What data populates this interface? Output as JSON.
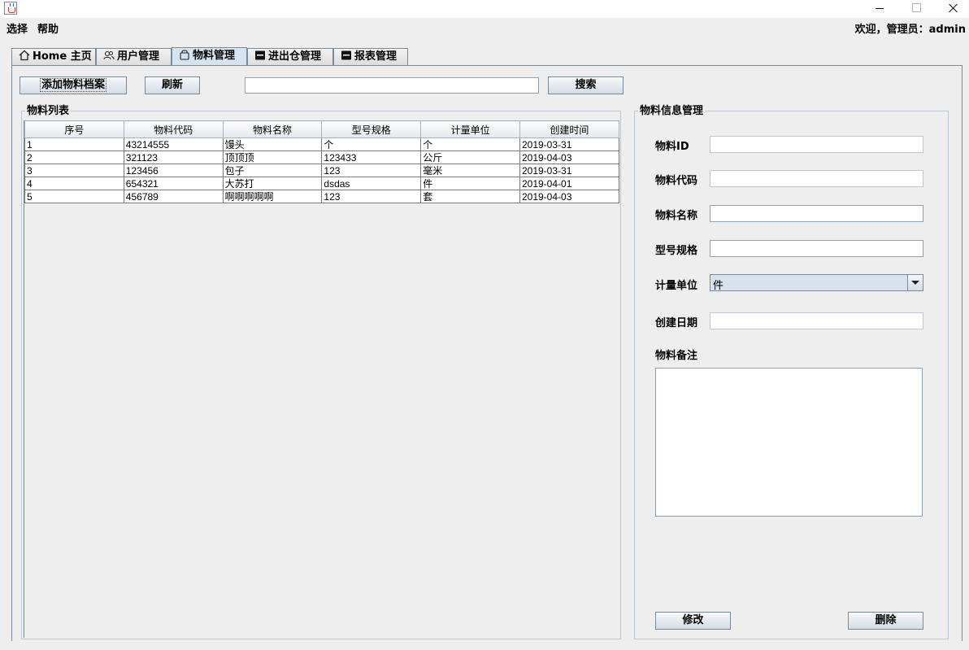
{
  "menu": {
    "select": "选择",
    "help": "帮助"
  },
  "welcome": "欢迎，管理员：admin",
  "tabs": [
    {
      "label": "Home 主页",
      "icon": "home-icon"
    },
    {
      "label": "用户管理",
      "icon": "users-icon"
    },
    {
      "label": "物料管理",
      "icon": "bag-icon"
    },
    {
      "label": "进出仓管理",
      "icon": "box-icon"
    },
    {
      "label": "报表管理",
      "icon": "box-icon"
    }
  ],
  "active_tab": "物料管理",
  "toolbar": {
    "add_label": "添加物料档案",
    "refresh_label": "刷新",
    "search_value": "",
    "search_label": "搜索"
  },
  "list": {
    "title": "物料列表",
    "columns": [
      "序号",
      "物料代码",
      "物料名称",
      "型号规格",
      "计量单位",
      "创建时间"
    ],
    "rows": [
      [
        "1",
        "43214555",
        "馒头",
        "个",
        "个",
        "2019-03-31"
      ],
      [
        "2",
        "321123",
        "顶顶顶",
        "123433",
        "公斤",
        "2019-04-03"
      ],
      [
        "3",
        "123456",
        "包子",
        "123",
        "毫米",
        "2019-03-31"
      ],
      [
        "4",
        "654321",
        "大苏打",
        "dsdas",
        "件",
        "2019-04-01"
      ],
      [
        "5",
        "456789",
        "啊啊啊啊啊",
        "123",
        "套",
        "2019-04-03"
      ]
    ]
  },
  "form": {
    "title": "物料信息管理",
    "id_label": "物料ID",
    "id_value": "",
    "code_label": "物料代码",
    "code_value": "",
    "name_label": "物料名称",
    "name_value": "",
    "spec_label": "型号规格",
    "spec_value": "",
    "unit_label": "计量单位",
    "unit_value": "件",
    "date_label": "创建日期",
    "date_value": "",
    "remark_label": "物料备注",
    "remark_value": "",
    "modify_label": "修改",
    "delete_label": "删除"
  }
}
